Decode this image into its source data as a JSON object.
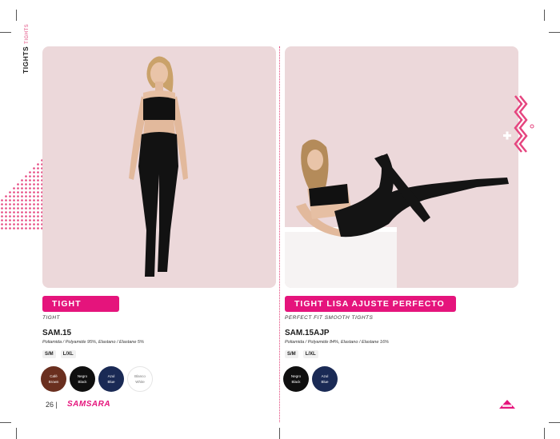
{
  "side_label": {
    "main": "TIGHTS",
    "sub": "TIGHTS"
  },
  "left": {
    "title": "TIGHT",
    "subtitle": "TIGHT",
    "code": "SAM.15",
    "composition": "Poliamida / Polyamide 95%, Elastano / Elastane 5%",
    "sizes": [
      "S/M",
      "L/XL"
    ],
    "colors": [
      {
        "line1": "Café",
        "line2": "Brown",
        "hex": "#6a2f1f",
        "text": "#ffffff"
      },
      {
        "line1": "Negro",
        "line2": "Black",
        "hex": "#0f0f0f",
        "text": "#ffffff"
      },
      {
        "line1": "Azul",
        "line2": "Blue",
        "hex": "#1a2a55",
        "text": "#ffffff"
      },
      {
        "line1": "Blanco",
        "line2": "White",
        "hex": "#ffffff",
        "text": "#777777"
      }
    ]
  },
  "right": {
    "title": "TIGHT LISA AJUSTE PERFECTO",
    "subtitle": "PERFECT FIT SMOOTH TIGHTS",
    "code": "SAM.15AJP",
    "composition": "Poliamida / Polyamide 84%, Elastano / Elastane 16%",
    "sizes": [
      "S/M",
      "L/XL"
    ],
    "colors": [
      {
        "line1": "Negro",
        "line2": "Black",
        "hex": "#0f0f0f",
        "text": "#ffffff"
      },
      {
        "line1": "Azul",
        "line2": "Blue",
        "hex": "#1a2a55",
        "text": "#ffffff"
      }
    ]
  },
  "footer": {
    "page": "26 |",
    "brand": "SAMSARA"
  },
  "colors": {
    "accent": "#e5147c",
    "panel_bg": "#ecd8da"
  }
}
